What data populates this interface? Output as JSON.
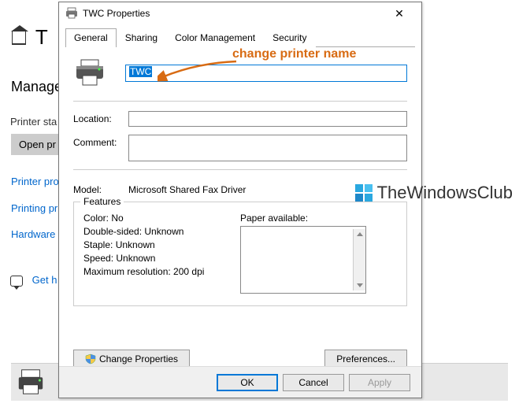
{
  "background": {
    "title_fragment": "T",
    "manage_heading": "Manage",
    "status_label": "Printer sta",
    "open_button": "Open pr",
    "links": [
      "Printer pro",
      "Printing pr",
      "Hardware"
    ],
    "help_link": "Get h"
  },
  "dialog": {
    "title": "TWC Properties",
    "tabs": [
      "General",
      "Sharing",
      "Color Management",
      "Security"
    ],
    "active_tab": 0,
    "printer_name": "TWC",
    "location_label": "Location:",
    "location_value": "",
    "comment_label": "Comment:",
    "comment_value": "",
    "model_label": "Model:",
    "model_value": "Microsoft Shared Fax Driver",
    "features": {
      "legend": "Features",
      "color": "Color: No",
      "double_sided": "Double-sided: Unknown",
      "staple": "Staple: Unknown",
      "speed": "Speed: Unknown",
      "max_resolution": "Maximum resolution: 200 dpi",
      "paper_label": "Paper available:"
    },
    "change_properties_btn": "Change Properties",
    "preferences_btn": "Preferences...",
    "ok_btn": "OK",
    "cancel_btn": "Cancel",
    "apply_btn": "Apply"
  },
  "annotation": "change printer name",
  "watermark": "TheWindowsClub"
}
